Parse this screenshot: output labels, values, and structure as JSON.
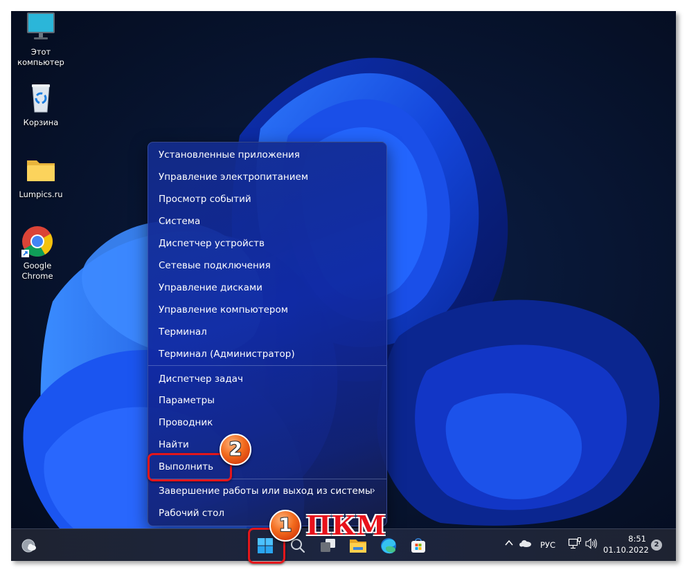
{
  "desktop": {
    "icons": [
      {
        "label_line1": "Этот",
        "label_line2": "компьютер",
        "icon": "monitor-icon"
      },
      {
        "label_line1": "Корзина",
        "label_line2": "",
        "icon": "recycle-bin-icon"
      },
      {
        "label_line1": "Lumpics.ru",
        "label_line2": "",
        "icon": "folder-icon"
      },
      {
        "label_line1": "Google",
        "label_line2": "Chrome",
        "icon": "chrome-icon"
      }
    ]
  },
  "context_menu": {
    "items": [
      {
        "label": "Установленные приложения"
      },
      {
        "label": "Управление электропитанием"
      },
      {
        "label": "Просмотр событий"
      },
      {
        "label": "Система"
      },
      {
        "label": "Диспетчер устройств"
      },
      {
        "label": "Сетевые подключения"
      },
      {
        "label": "Управление дисками"
      },
      {
        "label": "Управление компьютером"
      },
      {
        "label": "Терминал"
      },
      {
        "label": "Терминал (Администратор)"
      },
      {
        "label": "Диспетчер задач"
      },
      {
        "label": "Параметры"
      },
      {
        "label": "Проводник"
      },
      {
        "label": "Найти"
      },
      {
        "label": "Выполнить"
      },
      {
        "label": "Завершение работы или выход из системы",
        "submenu_arrow": "›"
      },
      {
        "label": "Рабочий стол"
      }
    ]
  },
  "taskbar": {
    "widgets_icon": "weather-widget-icon",
    "pinned": [
      {
        "name": "start-button",
        "icon": "windows-logo-icon"
      },
      {
        "name": "search-button",
        "icon": "search-icon"
      },
      {
        "name": "task-view-button",
        "icon": "task-view-icon"
      },
      {
        "name": "file-explorer-button",
        "icon": "folder-icon"
      },
      {
        "name": "edge-button",
        "icon": "edge-icon"
      },
      {
        "name": "store-button",
        "icon": "store-icon"
      }
    ],
    "tray": {
      "overflow_chevron": "^",
      "language": "РУС",
      "time": "8:51",
      "date": "01.10.2022",
      "notification_count": "2"
    }
  },
  "annotations": {
    "step1_number": "1",
    "step1_text": "ПКМ",
    "step2_number": "2",
    "highlight_color": "#e3161b",
    "badge_color": "#f26b1d"
  }
}
